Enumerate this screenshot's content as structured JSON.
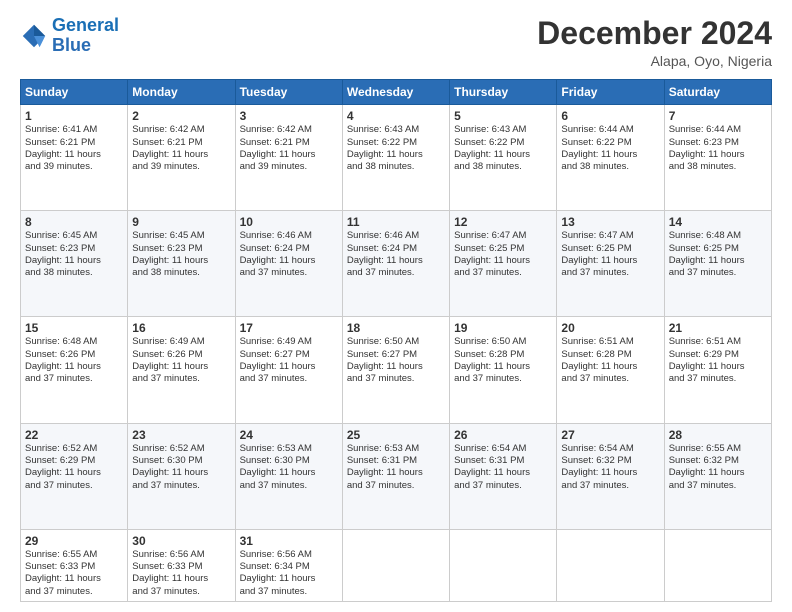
{
  "header": {
    "logo_general": "General",
    "logo_blue": "Blue",
    "month": "December 2024",
    "location": "Alapa, Oyo, Nigeria"
  },
  "days_header": [
    "Sunday",
    "Monday",
    "Tuesday",
    "Wednesday",
    "Thursday",
    "Friday",
    "Saturday"
  ],
  "weeks": [
    [
      {
        "day": "1",
        "lines": [
          "Sunrise: 6:41 AM",
          "Sunset: 6:21 PM",
          "Daylight: 11 hours",
          "and 39 minutes."
        ]
      },
      {
        "day": "2",
        "lines": [
          "Sunrise: 6:42 AM",
          "Sunset: 6:21 PM",
          "Daylight: 11 hours",
          "and 39 minutes."
        ]
      },
      {
        "day": "3",
        "lines": [
          "Sunrise: 6:42 AM",
          "Sunset: 6:21 PM",
          "Daylight: 11 hours",
          "and 39 minutes."
        ]
      },
      {
        "day": "4",
        "lines": [
          "Sunrise: 6:43 AM",
          "Sunset: 6:22 PM",
          "Daylight: 11 hours",
          "and 38 minutes."
        ]
      },
      {
        "day": "5",
        "lines": [
          "Sunrise: 6:43 AM",
          "Sunset: 6:22 PM",
          "Daylight: 11 hours",
          "and 38 minutes."
        ]
      },
      {
        "day": "6",
        "lines": [
          "Sunrise: 6:44 AM",
          "Sunset: 6:22 PM",
          "Daylight: 11 hours",
          "and 38 minutes."
        ]
      },
      {
        "day": "7",
        "lines": [
          "Sunrise: 6:44 AM",
          "Sunset: 6:23 PM",
          "Daylight: 11 hours",
          "and 38 minutes."
        ]
      }
    ],
    [
      {
        "day": "8",
        "lines": [
          "Sunrise: 6:45 AM",
          "Sunset: 6:23 PM",
          "Daylight: 11 hours",
          "and 38 minutes."
        ]
      },
      {
        "day": "9",
        "lines": [
          "Sunrise: 6:45 AM",
          "Sunset: 6:23 PM",
          "Daylight: 11 hours",
          "and 38 minutes."
        ]
      },
      {
        "day": "10",
        "lines": [
          "Sunrise: 6:46 AM",
          "Sunset: 6:24 PM",
          "Daylight: 11 hours",
          "and 37 minutes."
        ]
      },
      {
        "day": "11",
        "lines": [
          "Sunrise: 6:46 AM",
          "Sunset: 6:24 PM",
          "Daylight: 11 hours",
          "and 37 minutes."
        ]
      },
      {
        "day": "12",
        "lines": [
          "Sunrise: 6:47 AM",
          "Sunset: 6:25 PM",
          "Daylight: 11 hours",
          "and 37 minutes."
        ]
      },
      {
        "day": "13",
        "lines": [
          "Sunrise: 6:47 AM",
          "Sunset: 6:25 PM",
          "Daylight: 11 hours",
          "and 37 minutes."
        ]
      },
      {
        "day": "14",
        "lines": [
          "Sunrise: 6:48 AM",
          "Sunset: 6:25 PM",
          "Daylight: 11 hours",
          "and 37 minutes."
        ]
      }
    ],
    [
      {
        "day": "15",
        "lines": [
          "Sunrise: 6:48 AM",
          "Sunset: 6:26 PM",
          "Daylight: 11 hours",
          "and 37 minutes."
        ]
      },
      {
        "day": "16",
        "lines": [
          "Sunrise: 6:49 AM",
          "Sunset: 6:26 PM",
          "Daylight: 11 hours",
          "and 37 minutes."
        ]
      },
      {
        "day": "17",
        "lines": [
          "Sunrise: 6:49 AM",
          "Sunset: 6:27 PM",
          "Daylight: 11 hours",
          "and 37 minutes."
        ]
      },
      {
        "day": "18",
        "lines": [
          "Sunrise: 6:50 AM",
          "Sunset: 6:27 PM",
          "Daylight: 11 hours",
          "and 37 minutes."
        ]
      },
      {
        "day": "19",
        "lines": [
          "Sunrise: 6:50 AM",
          "Sunset: 6:28 PM",
          "Daylight: 11 hours",
          "and 37 minutes."
        ]
      },
      {
        "day": "20",
        "lines": [
          "Sunrise: 6:51 AM",
          "Sunset: 6:28 PM",
          "Daylight: 11 hours",
          "and 37 minutes."
        ]
      },
      {
        "day": "21",
        "lines": [
          "Sunrise: 6:51 AM",
          "Sunset: 6:29 PM",
          "Daylight: 11 hours",
          "and 37 minutes."
        ]
      }
    ],
    [
      {
        "day": "22",
        "lines": [
          "Sunrise: 6:52 AM",
          "Sunset: 6:29 PM",
          "Daylight: 11 hours",
          "and 37 minutes."
        ]
      },
      {
        "day": "23",
        "lines": [
          "Sunrise: 6:52 AM",
          "Sunset: 6:30 PM",
          "Daylight: 11 hours",
          "and 37 minutes."
        ]
      },
      {
        "day": "24",
        "lines": [
          "Sunrise: 6:53 AM",
          "Sunset: 6:30 PM",
          "Daylight: 11 hours",
          "and 37 minutes."
        ]
      },
      {
        "day": "25",
        "lines": [
          "Sunrise: 6:53 AM",
          "Sunset: 6:31 PM",
          "Daylight: 11 hours",
          "and 37 minutes."
        ]
      },
      {
        "day": "26",
        "lines": [
          "Sunrise: 6:54 AM",
          "Sunset: 6:31 PM",
          "Daylight: 11 hours",
          "and 37 minutes."
        ]
      },
      {
        "day": "27",
        "lines": [
          "Sunrise: 6:54 AM",
          "Sunset: 6:32 PM",
          "Daylight: 11 hours",
          "and 37 minutes."
        ]
      },
      {
        "day": "28",
        "lines": [
          "Sunrise: 6:55 AM",
          "Sunset: 6:32 PM",
          "Daylight: 11 hours",
          "and 37 minutes."
        ]
      }
    ],
    [
      {
        "day": "29",
        "lines": [
          "Sunrise: 6:55 AM",
          "Sunset: 6:33 PM",
          "Daylight: 11 hours",
          "and 37 minutes."
        ]
      },
      {
        "day": "30",
        "lines": [
          "Sunrise: 6:56 AM",
          "Sunset: 6:33 PM",
          "Daylight: 11 hours",
          "and 37 minutes."
        ]
      },
      {
        "day": "31",
        "lines": [
          "Sunrise: 6:56 AM",
          "Sunset: 6:34 PM",
          "Daylight: 11 hours",
          "and 37 minutes."
        ]
      },
      null,
      null,
      null,
      null
    ]
  ]
}
